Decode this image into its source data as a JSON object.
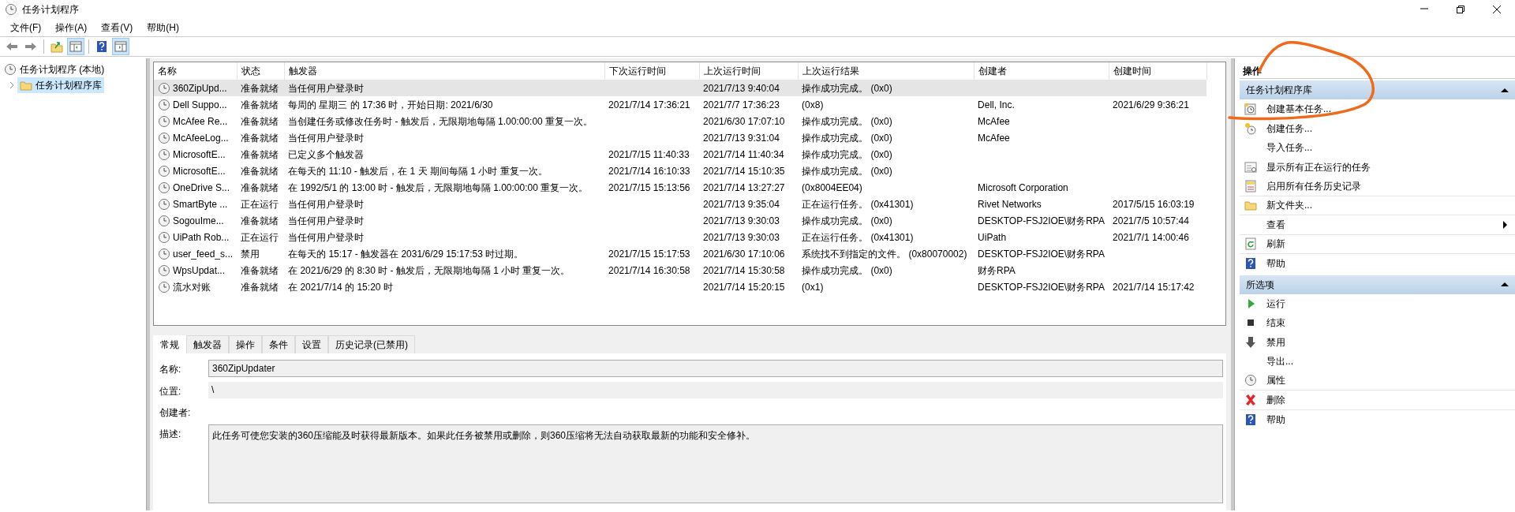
{
  "window": {
    "title": "任务计划程序"
  },
  "menu": [
    "文件(F)",
    "操作(A)",
    "查看(V)",
    "帮助(H)"
  ],
  "toolbar": [
    {
      "kind": "back",
      "pressed": false
    },
    {
      "kind": "forward",
      "pressed": false
    },
    {
      "kind": "folder-up",
      "pressed": false
    },
    {
      "kind": "panel-left",
      "pressed": true
    },
    {
      "kind": "help",
      "pressed": false
    },
    {
      "kind": "panel-right",
      "pressed": true
    }
  ],
  "tree": [
    {
      "label": "任务计划程序 (本地)",
      "kind": "clock",
      "selected": false,
      "children": [
        {
          "label": "任务计划程序库",
          "kind": "folder",
          "selected": true,
          "expanded": false
        }
      ]
    }
  ],
  "table": {
    "columns": [
      "名称",
      "状态",
      "触发器",
      "下次运行时间",
      "上次运行时间",
      "上次运行结果",
      "创建者",
      "创建时间"
    ],
    "rows": [
      {
        "selected": true,
        "cells": [
          "360ZipUpd...",
          "准备就绪",
          "当任何用户登录时",
          "",
          "2021/7/13 9:40:04",
          "操作成功完成。 (0x0)",
          "",
          ""
        ]
      },
      {
        "selected": false,
        "cells": [
          "Dell Suppo...",
          "准备就绪",
          "每周的 星期三 的 17:36 时，开始日期: 2021/6/30",
          "2021/7/14 17:36:21",
          "2021/7/7 17:36:23",
          "(0x8)",
          "Dell, Inc.",
          "2021/6/29 9:36:21"
        ]
      },
      {
        "selected": false,
        "cells": [
          "McAfee Re...",
          "准备就绪",
          "当创建任务或修改任务时 - 触发后，无限期地每隔 1.00:00:00 重复一次。",
          "",
          "2021/6/30 17:07:10",
          "操作成功完成。 (0x0)",
          "McAfee",
          ""
        ]
      },
      {
        "selected": false,
        "cells": [
          "McAfeeLog...",
          "准备就绪",
          "当任何用户登录时",
          "",
          "2021/7/13 9:31:04",
          "操作成功完成。 (0x0)",
          "McAfee",
          ""
        ]
      },
      {
        "selected": false,
        "cells": [
          "MicrosoftE...",
          "准备就绪",
          "已定义多个触发器",
          "2021/7/15 11:40:33",
          "2021/7/14 11:40:34",
          "操作成功完成。 (0x0)",
          "",
          ""
        ]
      },
      {
        "selected": false,
        "cells": [
          "MicrosoftE...",
          "准备就绪",
          "在每天的 11:10 - 触发后，在 1 天 期间每隔 1 小时 重复一次。",
          "2021/7/14 16:10:33",
          "2021/7/14 15:10:35",
          "操作成功完成。 (0x0)",
          "",
          ""
        ]
      },
      {
        "selected": false,
        "cells": [
          "OneDrive S...",
          "准备就绪",
          "在 1992/5/1 的 13:00 时 - 触发后，无限期地每隔 1.00:00:00 重复一次。",
          "2021/7/15 15:13:56",
          "2021/7/14 13:27:27",
          "(0x8004EE04)",
          "Microsoft Corporation",
          ""
        ]
      },
      {
        "selected": false,
        "cells": [
          "SmartByte ...",
          "正在运行",
          "当任何用户登录时",
          "",
          "2021/7/13 9:35:04",
          "正在运行任务。 (0x41301)",
          "Rivet Networks",
          "2017/5/15 16:03:19"
        ]
      },
      {
        "selected": false,
        "cells": [
          "SogouIme...",
          "准备就绪",
          "当任何用户登录时",
          "",
          "2021/7/13 9:30:03",
          "操作成功完成。 (0x0)",
          "DESKTOP-FSJ2IOE\\财务RPA",
          "2021/7/5 10:57:44"
        ]
      },
      {
        "selected": false,
        "cells": [
          "UiPath Rob...",
          "正在运行",
          "当任何用户登录时",
          "",
          "2021/7/13 9:30:03",
          "正在运行任务。 (0x41301)",
          "UiPath",
          "2021/7/1 14:00:46"
        ]
      },
      {
        "selected": false,
        "cells": [
          "user_feed_s...",
          "禁用",
          "在每天的 15:17 - 触发器在 2031/6/29 15:17:53 时过期。",
          "2021/7/15 15:17:53",
          "2021/6/30 17:10:06",
          "系统找不到指定的文件。 (0x80070002)",
          "DESKTOP-FSJ2IOE\\财务RPA",
          ""
        ]
      },
      {
        "selected": false,
        "cells": [
          "WpsUpdat...",
          "准备就绪",
          "在 2021/6/29 的 8:30 时 - 触发后，无限期地每隔 1 小时 重复一次。",
          "2021/7/14 16:30:58",
          "2021/7/14 15:30:58",
          "操作成功完成。 (0x0)",
          "财务RPA",
          ""
        ]
      },
      {
        "selected": false,
        "cells": [
          "流水对账",
          "准备就绪",
          "在 2021/7/14 的 15:20 时",
          "",
          "2021/7/14 15:20:15",
          "(0x1)",
          "DESKTOP-FSJ2IOE\\财务RPA",
          "2021/7/14 15:17:42"
        ]
      }
    ]
  },
  "details": {
    "tabs": [
      {
        "label": "常规",
        "selected": true
      },
      {
        "label": "触发器",
        "selected": false
      },
      {
        "label": "操作",
        "selected": false
      },
      {
        "label": "条件",
        "selected": false
      },
      {
        "label": "设置",
        "selected": false
      },
      {
        "label": "历史记录(已禁用)",
        "selected": false
      }
    ],
    "fields": [
      {
        "label": "名称:",
        "kind": "input",
        "value": "360ZipUpdater"
      },
      {
        "label": "位置:",
        "kind": "text",
        "value": "\\"
      },
      {
        "label": "创建者:",
        "kind": "text"
      },
      {
        "label": "描述:",
        "kind": "textarea",
        "value": "此任务可使您安装的360压缩能及时获得最新版本。如果此任务被禁用或删除，则360压缩将无法自动获取最新的功能和安全修补。"
      }
    ]
  },
  "actions": {
    "title": "操作",
    "sections": [
      {
        "title": "任务计划程序库",
        "expanded": true,
        "items": [
          {
            "label": "创建基本任务...",
            "kind": "clock-page",
            "submenu": false
          },
          {
            "label": "创建任务...",
            "kind": "clock-star",
            "submenu": false
          },
          {
            "label": "导入任务...",
            "kind": "none",
            "submenu": false
          },
          {
            "label": "显示所有正在运行的任务",
            "kind": "list",
            "submenu": false
          },
          {
            "label": "启用所有任务历史记录",
            "kind": "log",
            "submenu": false
          },
          {
            "label": "新文件夹...",
            "kind": "folder",
            "submenu": false
          },
          {
            "label": "查看",
            "kind": "none",
            "submenu": true
          },
          {
            "label": "刷新",
            "kind": "refresh",
            "submenu": false
          },
          {
            "label": "帮助",
            "kind": "help",
            "submenu": false
          }
        ]
      },
      {
        "title": "所选项",
        "expanded": true,
        "items": [
          {
            "label": "运行",
            "kind": "run",
            "submenu": false
          },
          {
            "label": "结束",
            "kind": "stop",
            "submenu": false
          },
          {
            "label": "禁用",
            "kind": "down",
            "submenu": false
          },
          {
            "label": "导出...",
            "kind": "none",
            "submenu": false
          },
          {
            "label": "属性",
            "kind": "clock",
            "submenu": false
          },
          {
            "label": "删除",
            "kind": "delete",
            "submenu": false
          },
          {
            "label": "帮助",
            "kind": "help",
            "submenu": false
          }
        ]
      }
    ]
  }
}
